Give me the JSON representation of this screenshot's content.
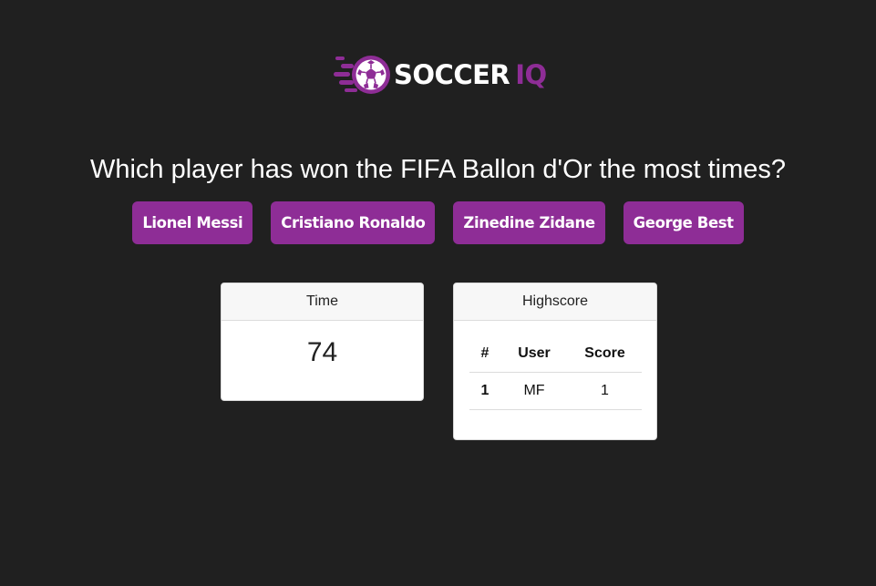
{
  "brand": {
    "name_primary": "SOCCER",
    "name_accent": "IQ",
    "accent_color": "#8e2d96",
    "background_color": "#202020",
    "logo_icon": "soccer-ball-icon"
  },
  "quiz": {
    "question": "Which player has won the FIFA Ballon d'Or the most times?",
    "answers": [
      {
        "label": "Lionel Messi"
      },
      {
        "label": "Cristiano Ronaldo"
      },
      {
        "label": "Zinedine Zidane"
      },
      {
        "label": "George Best"
      }
    ]
  },
  "timer": {
    "title": "Time",
    "value": "74"
  },
  "highscore": {
    "title": "Highscore",
    "columns": [
      "#",
      "User",
      "Score"
    ],
    "rows": [
      {
        "rank": "1",
        "user": "MF",
        "score": "1"
      }
    ]
  }
}
